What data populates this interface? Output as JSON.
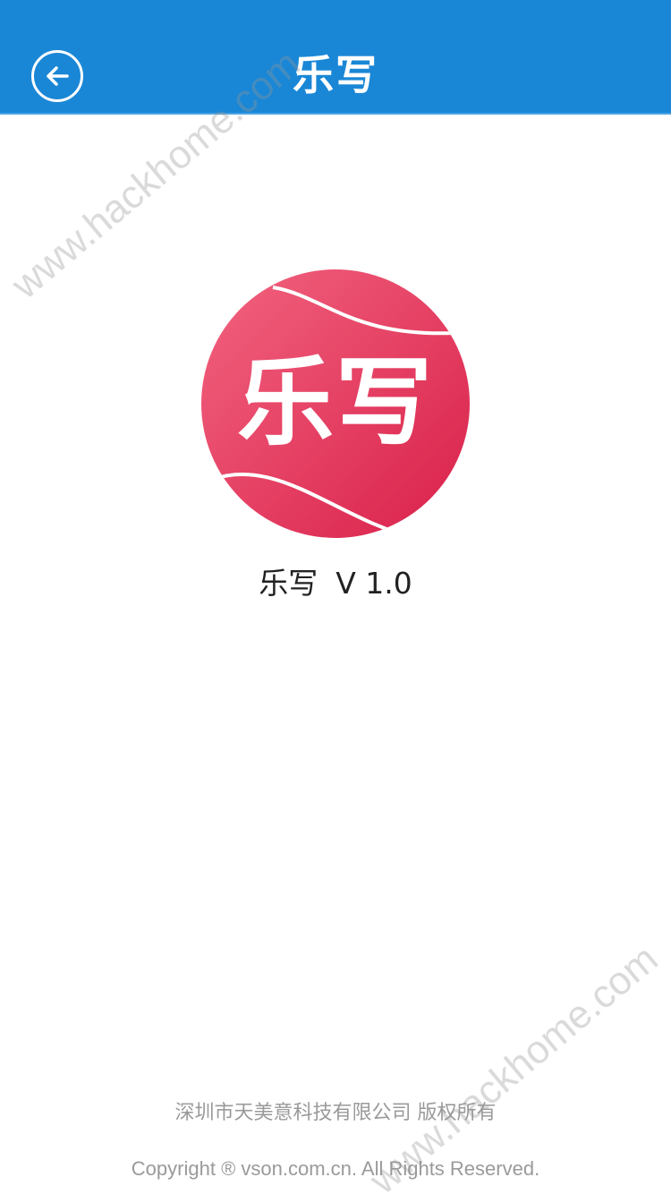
{
  "header": {
    "title": "乐写",
    "back_icon": "back-arrow-icon",
    "background_color": "#1a87d6"
  },
  "logo": {
    "text": "乐写",
    "colors": [
      "#f2647f",
      "#e0284f"
    ]
  },
  "app": {
    "name": "乐写",
    "version": "V 1.0"
  },
  "footer": {
    "company": "深圳市天美意科技有限公司 版权所有",
    "copyright": "Copyright ® vson.com.cn. All Rights Reserved."
  },
  "watermark": {
    "text": "www.hackhome.com"
  }
}
